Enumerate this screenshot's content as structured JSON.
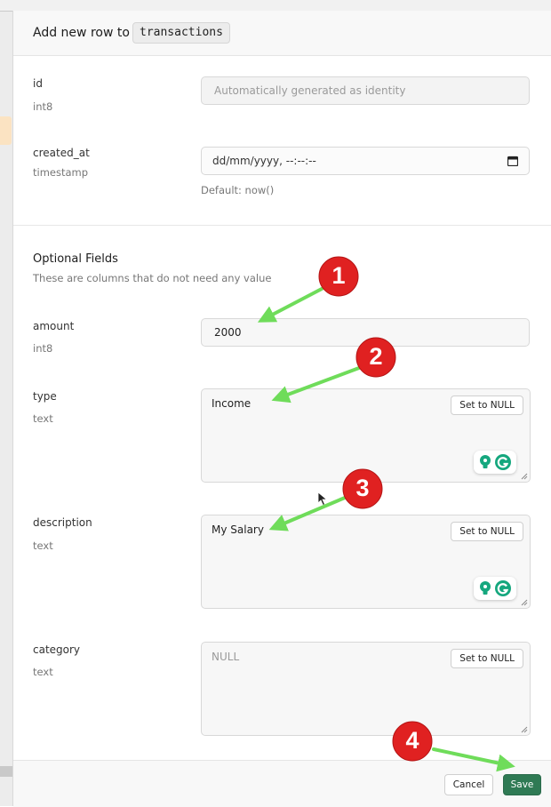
{
  "header": {
    "title": "Add new row to",
    "table_name": "transactions"
  },
  "fields": {
    "id": {
      "name": "id",
      "type": "int8",
      "placeholder": "Automatically generated as identity"
    },
    "created_at": {
      "name": "created_at",
      "type": "timestamp",
      "placeholder": "dd/mm/yyyy, --:--:--",
      "hint": "Default: now()"
    }
  },
  "optional": {
    "title": "Optional Fields",
    "subtitle": "These are columns that do not need any value"
  },
  "optional_fields": {
    "amount": {
      "name": "amount",
      "type": "int8",
      "value": "2000"
    },
    "type": {
      "name": "type",
      "type": "text",
      "value": "Income",
      "null_button": "Set to NULL"
    },
    "description": {
      "name": "description",
      "type": "text",
      "value": "My Salary",
      "null_button": "Set to NULL"
    },
    "category": {
      "name": "category",
      "type": "text",
      "placeholder": "NULL",
      "null_button": "Set to NULL"
    }
  },
  "footer": {
    "cancel_label": "Cancel",
    "save_label": "Save"
  },
  "annotations": {
    "markers": [
      "1",
      "2",
      "3",
      "4"
    ],
    "marker_color": "#e02121",
    "arrow_color": "#6fdc5a"
  },
  "colors": {
    "save_button": "#2f7a54",
    "grammarly_green": "#15a77e"
  }
}
